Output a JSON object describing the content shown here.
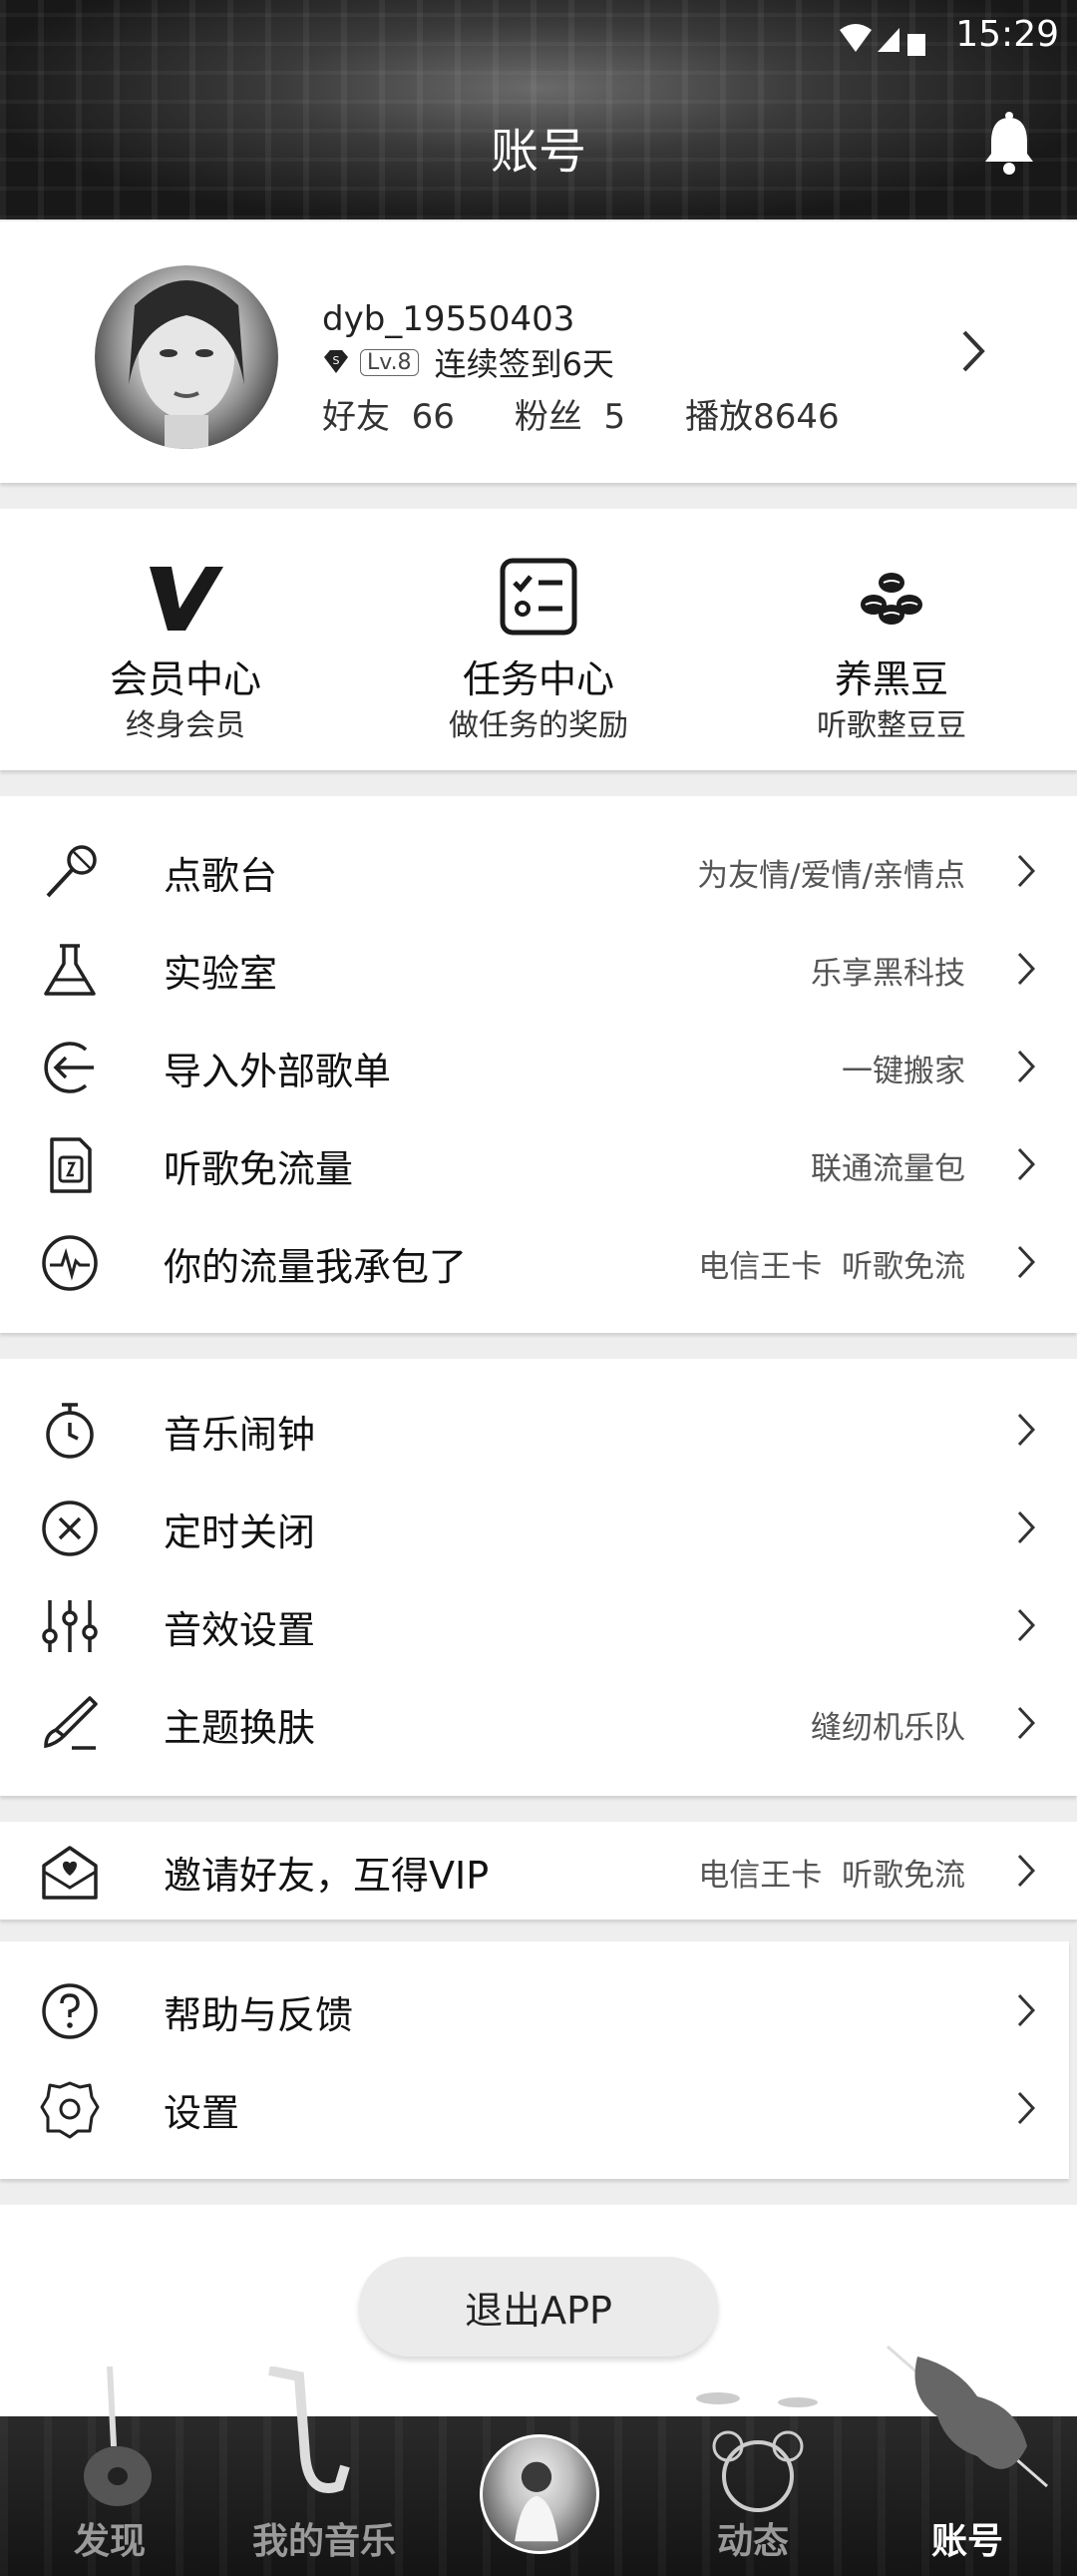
{
  "status_bar": {
    "time": "15:29"
  },
  "header": {
    "title": "账号"
  },
  "profile": {
    "username": "dyb_19550403",
    "level": "Lv.8",
    "checkin": "连续签到6天",
    "friends_label": "好友",
    "friends": "66",
    "fans_label": "粉丝",
    "fans": "5",
    "plays": "播放8646"
  },
  "features": [
    {
      "title": "会员中心",
      "subtitle": "终身会员",
      "icon": "vip-v-icon"
    },
    {
      "title": "任务中心",
      "subtitle": "做任务的奖励",
      "icon": "checklist-icon"
    },
    {
      "title": "养黑豆",
      "subtitle": "听歌整豆豆",
      "icon": "beans-icon"
    }
  ],
  "section1": [
    {
      "label": "点歌台",
      "hint": "为友情/爱情/亲情点",
      "icon": "microphone-icon"
    },
    {
      "label": "实验室",
      "hint": "乐享黑科技",
      "icon": "flask-icon"
    },
    {
      "label": "导入外部歌单",
      "hint": "一键搬家",
      "icon": "import-arrow-icon"
    },
    {
      "label": "听歌免流量",
      "hint": "联通流量包",
      "icon": "sim-card-icon"
    },
    {
      "label": "你的流量我承包了",
      "hint": "电信王卡  听歌免流",
      "icon": "pulse-icon"
    }
  ],
  "section2": [
    {
      "label": "音乐闹钟",
      "hint": "",
      "icon": "alarm-clock-icon"
    },
    {
      "label": "定时关闭",
      "hint": "",
      "icon": "close-circle-icon"
    },
    {
      "label": "音效设置",
      "hint": "",
      "icon": "equalizer-icon"
    },
    {
      "label": "主题换肤",
      "hint": "缝纫机乐队",
      "icon": "brush-icon"
    }
  ],
  "section3": [
    {
      "label": "邀请好友，互得VIP",
      "hint": "电信王卡  听歌免流",
      "icon": "invite-envelope-icon"
    }
  ],
  "section4": [
    {
      "label": "帮助与反馈",
      "hint": "",
      "icon": "help-icon"
    },
    {
      "label": "设置",
      "hint": "",
      "icon": "settings-icon"
    }
  ],
  "logout": "退出APP",
  "tabs": [
    {
      "label": "发现"
    },
    {
      "label": "我的音乐"
    },
    {
      "label": "动态"
    },
    {
      "label": "账号"
    }
  ],
  "colors": {
    "header": "#2b2b2b",
    "active_tab": "#ffffff",
    "inactive_tab": "#9a9a9a"
  }
}
